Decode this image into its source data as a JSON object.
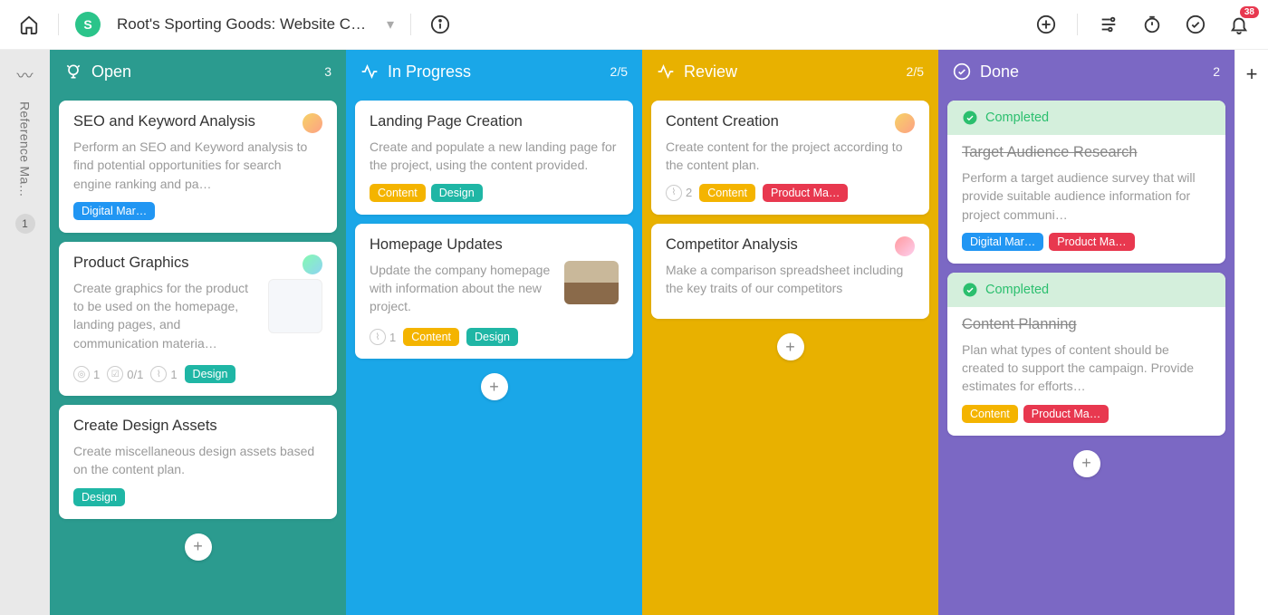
{
  "header": {
    "logo_letter": "S",
    "board_title": "Root's Sporting Goods: Website Cre…",
    "notif_count": "38"
  },
  "sidebar": {
    "label": "Reference Ma…",
    "count": "1"
  },
  "columns": [
    {
      "key": "open",
      "title": "Open",
      "count": "3",
      "cards": [
        {
          "title": "SEO and Keyword Analysis",
          "desc": "Perform an SEO and Keyword analysis to find potential opportunities for search engine ranking and pa…",
          "avatar": "av-1",
          "tags": [
            {
              "text": "Digital Mar…",
              "cls": "tag-blue"
            }
          ]
        },
        {
          "title": "Product Graphics",
          "desc": "Create graphics for the product to be used on the homepage, landing pages, and communication materia…",
          "avatar": "av-2",
          "thumb": "ui",
          "meta": {
            "sub": "1",
            "check": "0/1",
            "attach": "1"
          },
          "tags": [
            {
              "text": "Design",
              "cls": "tag-teal"
            }
          ]
        },
        {
          "title": "Create Design Assets",
          "desc": "Create miscellaneous design assets based on the content plan.",
          "tags": [
            {
              "text": "Design",
              "cls": "tag-teal"
            }
          ]
        }
      ]
    },
    {
      "key": "progress",
      "title": "In Progress",
      "count": "2/5",
      "cards": [
        {
          "title": "Landing Page Creation",
          "desc": "Create and populate a new landing page for the project, using the content provided.",
          "tags": [
            {
              "text": "Content",
              "cls": "tag-yellow"
            },
            {
              "text": "Design",
              "cls": "tag-teal"
            }
          ]
        },
        {
          "title": "Homepage Updates",
          "desc": "Update the company homepage with information about the new project.",
          "thumb": "photo",
          "meta": {
            "attach": "1"
          },
          "tags": [
            {
              "text": "Content",
              "cls": "tag-yellow"
            },
            {
              "text": "Design",
              "cls": "tag-teal"
            }
          ]
        }
      ]
    },
    {
      "key": "review",
      "title": "Review",
      "count": "2/5",
      "cards": [
        {
          "title": "Content Creation",
          "desc": "Create content for the project according to the content plan.",
          "avatar": "av-1",
          "meta": {
            "attach": "2"
          },
          "tags": [
            {
              "text": "Content",
              "cls": "tag-yellow"
            },
            {
              "text": "Product Ma…",
              "cls": "tag-pink"
            }
          ]
        },
        {
          "title": "Competitor Analysis",
          "desc": "Make a comparison spreadsheet including the key traits of our competitors",
          "avatar": "av-3"
        }
      ]
    },
    {
      "key": "done",
      "title": "Done",
      "count": "2",
      "cards": [
        {
          "completed": true,
          "completed_label": "Completed",
          "title": "Target Audience Research",
          "desc": "Perform a target audience survey that will provide suitable audience information for project communi…",
          "tags": [
            {
              "text": "Digital Mar…",
              "cls": "tag-blue"
            },
            {
              "text": "Product Ma…",
              "cls": "tag-pink"
            }
          ]
        },
        {
          "completed": true,
          "completed_label": "Completed",
          "title": "Content Planning",
          "desc": "Plan what types of content should be created to support the campaign. Provide estimates for efforts…",
          "tags": [
            {
              "text": "Content",
              "cls": "tag-yellow"
            },
            {
              "text": "Product Ma…",
              "cls": "tag-pink"
            }
          ]
        }
      ]
    }
  ],
  "icons": {
    "home": "home",
    "info": "info",
    "add": "add",
    "flow": "flow",
    "timer": "timer",
    "check": "check",
    "bell": "bell",
    "plus": "plus"
  }
}
